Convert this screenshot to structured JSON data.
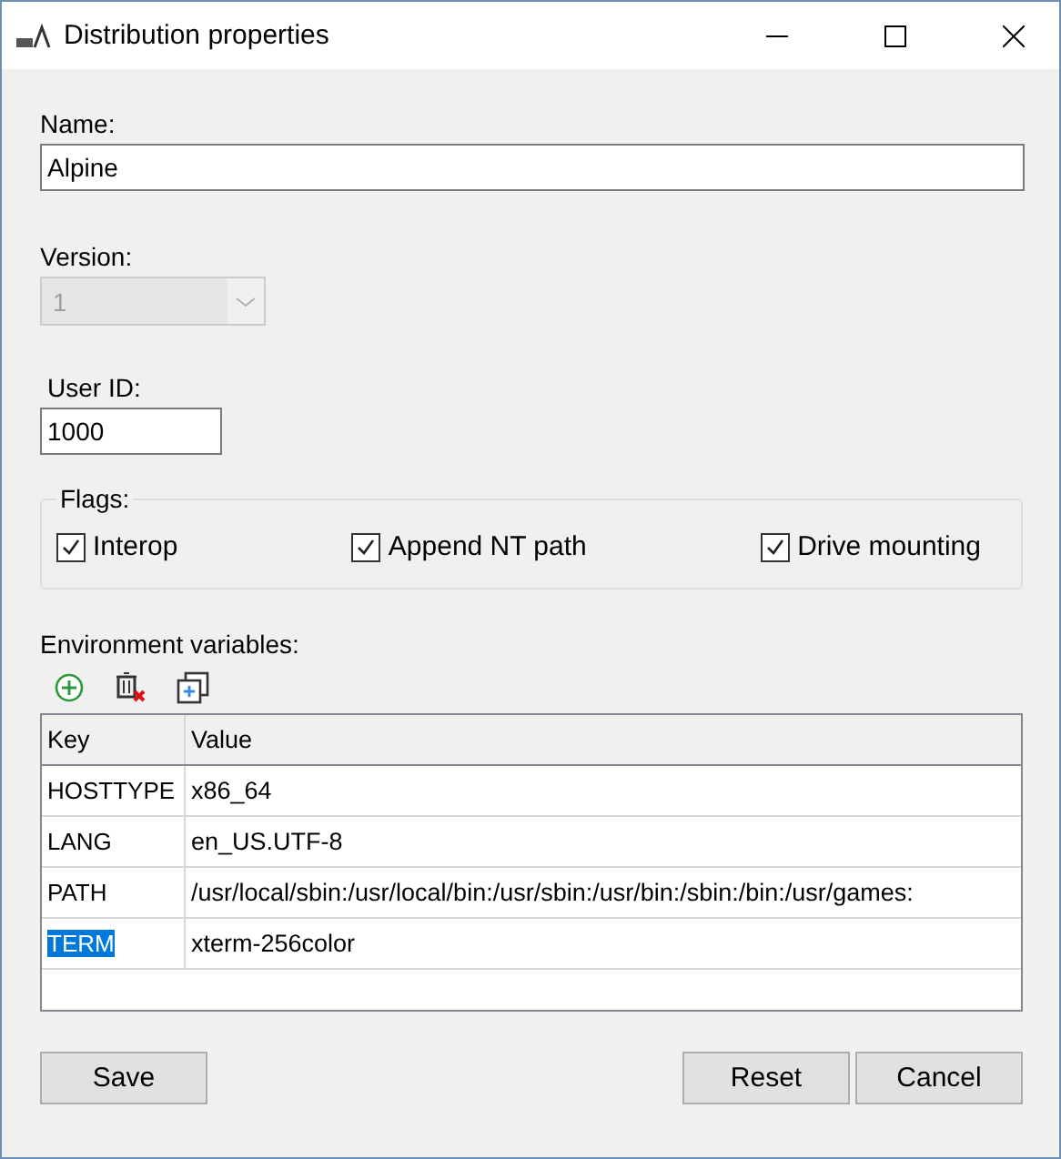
{
  "window": {
    "title": "Distribution properties"
  },
  "name_field": {
    "label": "Name:",
    "value": "Alpine"
  },
  "version_field": {
    "label": "Version:",
    "value": "1",
    "disabled": true
  },
  "user_id_field": {
    "label": "User ID:",
    "value": "1000"
  },
  "flags": {
    "title": "Flags:",
    "items": [
      {
        "label": "Interop",
        "checked": true
      },
      {
        "label": "Append NT path",
        "checked": true
      },
      {
        "label": "Drive mounting",
        "checked": true
      }
    ]
  },
  "environment": {
    "label": "Environment variables:",
    "columns": [
      "Key",
      "Value"
    ],
    "rows": [
      {
        "key": "HOSTTYPE",
        "value": "x86_64",
        "selected": false
      },
      {
        "key": "LANG",
        "value": "en_US.UTF-8",
        "selected": false
      },
      {
        "key": "PATH",
        "value": "/usr/local/sbin:/usr/local/bin:/usr/sbin:/usr/bin:/sbin:/bin:/usr/games:",
        "selected": false
      },
      {
        "key": "TERM",
        "value": "xterm-256color",
        "selected": true
      }
    ]
  },
  "buttons": [
    {
      "label": "Save",
      "kind": "left"
    },
    {
      "label": "Reset",
      "kind": "right"
    },
    {
      "label": "Cancel",
      "kind": "right"
    }
  ]
}
